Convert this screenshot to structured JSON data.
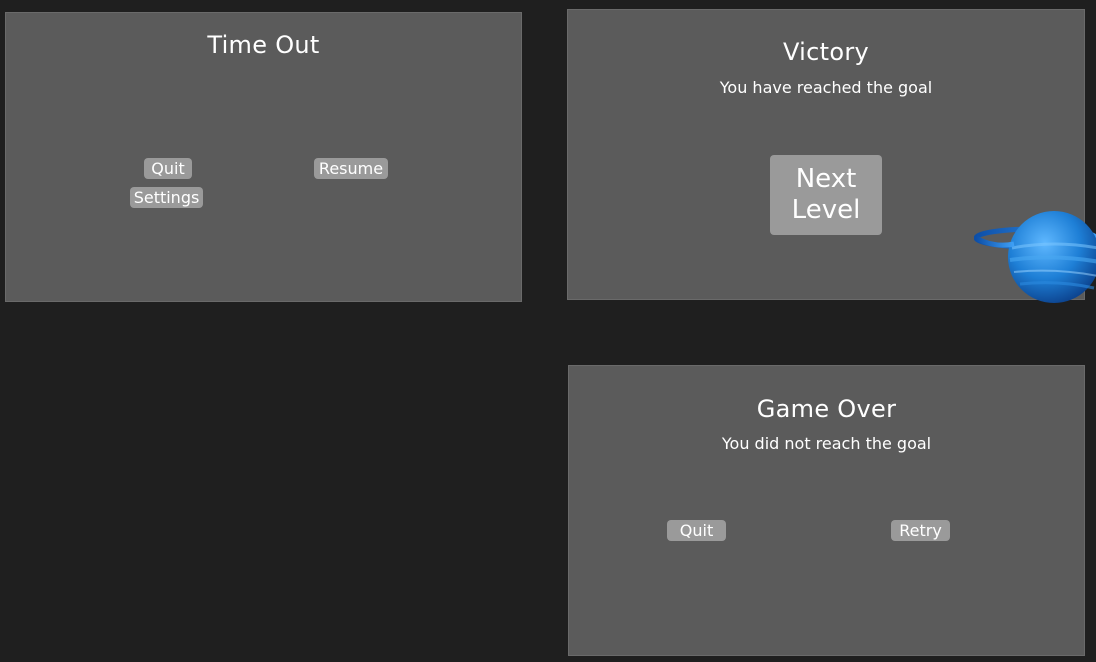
{
  "pause_panel": {
    "title": "Time Out",
    "quit_label": "Quit",
    "resume_label": "Resume",
    "settings_label": "Settings"
  },
  "victory_panel": {
    "title": "Victory",
    "subtitle": "You have reached the goal",
    "next_level_label": "Next\nLevel",
    "decoration_icon": "ringed-planet-icon"
  },
  "game_over_panel": {
    "title": "Game Over",
    "subtitle": "You did not reach the goal",
    "quit_label": "Quit",
    "retry_label": "Retry"
  },
  "colors": {
    "background": "#1f1f1f",
    "panel": "#5b5b5b",
    "button": "#9a9a9a",
    "text": "#ffffff",
    "planet": "#1e7fd6"
  }
}
